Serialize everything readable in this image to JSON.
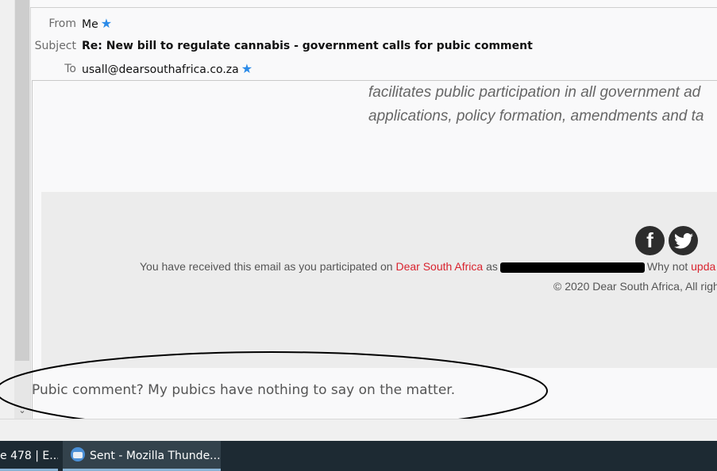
{
  "header": {
    "from_label": "From",
    "from_value": "Me",
    "subject_label": "Subject",
    "subject_value": "Re: New bill to regulate cannabis - government calls for pubic comment",
    "to_label": "To",
    "to_value": "usall@dearsouthafrica.co.za"
  },
  "body": {
    "quoted_line1": "facilitates public participation in all government ad",
    "quoted_line2": "applications, policy formation, amendments and ta",
    "footer_text_prefix": "You have received this email as you participated on",
    "footer_link": "Dear South Africa",
    "footer_as": "as",
    "footer_why": "Why not",
    "footer_update": "upda",
    "copyright": "© 2020 Dear South Africa, All righ",
    "reply": "Pubic comment? My pubics have nothing to say on the matter."
  },
  "social": {
    "facebook_glyph": "f",
    "twitter_glyph": "t"
  },
  "taskbar": {
    "item1": "e 478 | E...",
    "item2": "Sent - Mozilla Thunde..."
  }
}
